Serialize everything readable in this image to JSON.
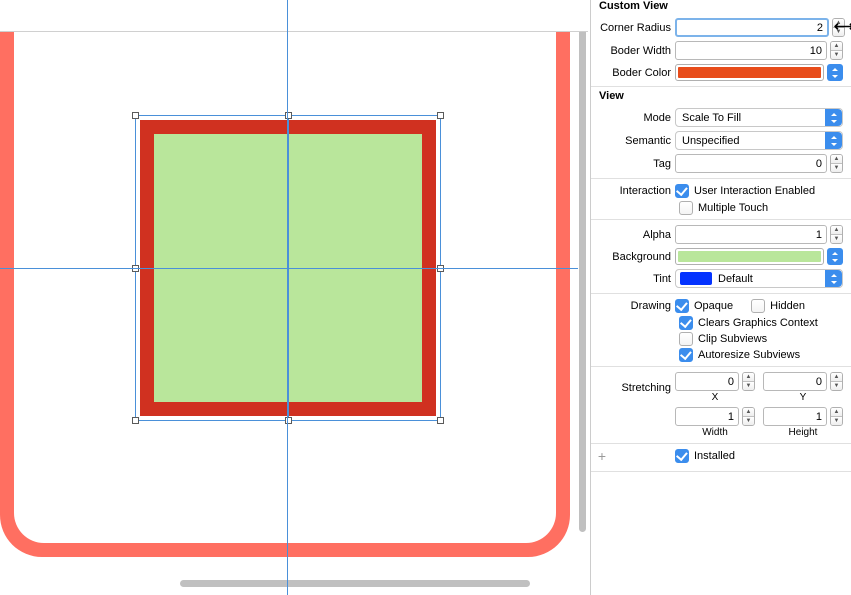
{
  "customView": {
    "header": "Custom View",
    "cornerRadius": {
      "label": "Corner Radius",
      "value": "2"
    },
    "borderWidth": {
      "label": "Boder Width",
      "value": "10"
    },
    "borderColor": {
      "label": "Boder Color",
      "hex": "#e84c1a"
    }
  },
  "view": {
    "header": "View",
    "mode": {
      "label": "Mode",
      "value": "Scale To Fill"
    },
    "semantic": {
      "label": "Semantic",
      "value": "Unspecified"
    },
    "tag": {
      "label": "Tag",
      "value": "0"
    },
    "interaction": {
      "label": "Interaction",
      "userInteraction": {
        "label": "User Interaction Enabled",
        "checked": true
      },
      "multipleTouch": {
        "label": "Multiple Touch",
        "checked": false
      }
    },
    "alpha": {
      "label": "Alpha",
      "value": "1"
    },
    "background": {
      "label": "Background",
      "hex": "#b9e69b"
    },
    "tint": {
      "label": "Tint",
      "value": "Default",
      "hex": "#0433ff"
    },
    "drawing": {
      "label": "Drawing",
      "opaque": {
        "label": "Opaque",
        "checked": true
      },
      "hidden": {
        "label": "Hidden",
        "checked": false
      },
      "clears": {
        "label": "Clears Graphics Context",
        "checked": true
      },
      "clip": {
        "label": "Clip Subviews",
        "checked": false
      },
      "autoresize": {
        "label": "Autoresize Subviews",
        "checked": true
      }
    },
    "stretching": {
      "label": "Stretching",
      "x": {
        "label": "X",
        "value": "0"
      },
      "y": {
        "label": "Y",
        "value": "0"
      },
      "width": {
        "label": "Width",
        "value": "1"
      },
      "height": {
        "label": "Height",
        "value": "1"
      }
    },
    "installed": {
      "label": "Installed",
      "checked": true
    }
  }
}
